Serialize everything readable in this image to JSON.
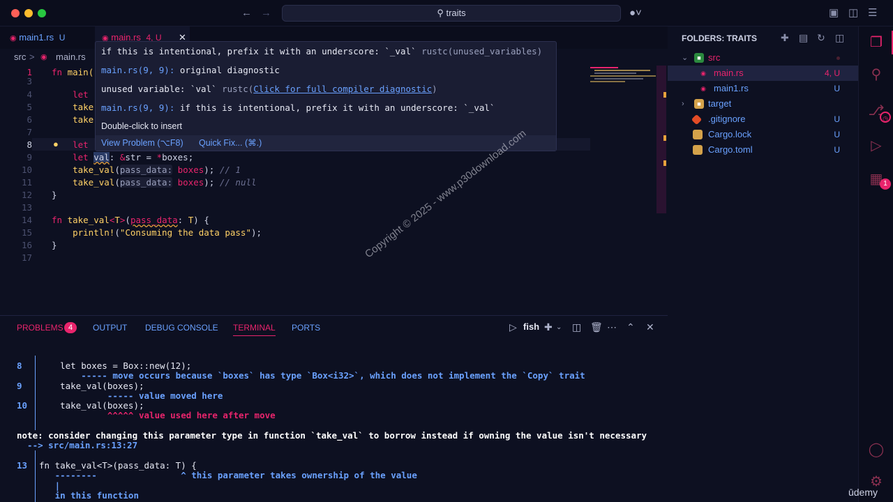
{
  "titlebar": {
    "search_text": "traits"
  },
  "tabs": [
    {
      "label": "main1.rs",
      "status": "U"
    },
    {
      "label": "main.rs",
      "status": "4, U"
    }
  ],
  "breadcrumb": {
    "folder": "src",
    "file": "main.rs",
    "sep": ">"
  },
  "editor": {
    "lines": [
      {
        "n": "1",
        "text": "fn main("
      },
      {
        "n": "3",
        "text": ""
      },
      {
        "n": "4",
        "text": "    let"
      },
      {
        "n": "5",
        "text": "    take"
      },
      {
        "n": "6",
        "text": "    take"
      },
      {
        "n": "7",
        "text": ""
      },
      {
        "n": "8",
        "text": "    let"
      },
      {
        "n": "9",
        "text": "    let val: &str = *boxes;"
      },
      {
        "n": "10",
        "text": "    take_val(pass_data: boxes); // 1"
      },
      {
        "n": "11",
        "text": "    take_val(pass_data: boxes); // null"
      },
      {
        "n": "12",
        "text": "}"
      },
      {
        "n": "13",
        "text": ""
      },
      {
        "n": "14",
        "text": "fn take_val<T>(pass_data: T) {"
      },
      {
        "n": "15",
        "text": "    println!(\"Consuming the data pass\");"
      },
      {
        "n": "16",
        "text": "}"
      },
      {
        "n": "17",
        "text": ""
      }
    ]
  },
  "hover": {
    "line1_a": "if this is intentional, prefix it with an underscore: `_val`",
    "line1_b": "rustc(unused_variables)",
    "line2_link": "main.rs(9, 9):",
    "line2_text": "original diagnostic",
    "line3_a": "unused variable: `val`",
    "line3_b": "rustc(",
    "line3_link": "Click for full compiler diagnostic",
    "line3_c": ")",
    "line4_link": "main.rs(9, 9):",
    "line4_text": "if this is intentional, prefix it with an underscore: `_val`",
    "line5": "Double-click to insert",
    "view_problem": "View Problem (⌥F8)",
    "quick_fix": "Quick Fix... (⌘.)"
  },
  "explorer": {
    "header": "FOLDERS: TRAITS",
    "items": [
      {
        "name": "src",
        "status": ""
      },
      {
        "name": "main.rs",
        "status": "4, U"
      },
      {
        "name": "main1.rs",
        "status": "U"
      },
      {
        "name": "target",
        "status": ""
      },
      {
        "name": ".gitignore",
        "status": "U"
      },
      {
        "name": "Cargo.lock",
        "status": "U"
      },
      {
        "name": "Cargo.toml",
        "status": "U"
      }
    ]
  },
  "activity": {
    "scm_badge": "1"
  },
  "panel": {
    "tabs": {
      "problems": "PROBLEMS",
      "problems_count": "4",
      "output": "OUTPUT",
      "debug": "DEBUG CONSOLE",
      "terminal": "TERMINAL",
      "ports": "PORTS"
    },
    "shell": "fish",
    "terminal_lines": [
      {
        "gutter": "8",
        "text": "    let boxes = Box::new(12);"
      },
      {
        "gutter": "",
        "text": "        ----- move occurs because `boxes` has type `Box<i32>`, which does not implement the `Copy` trait"
      },
      {
        "gutter": "9",
        "text": "    take_val(boxes);"
      },
      {
        "gutter": "",
        "text": "             ----- value moved here"
      },
      {
        "gutter": "10",
        "text": "    take_val(boxes);"
      },
      {
        "gutter": "",
        "text": "             ^^^^^ value used here after move"
      },
      {
        "gutter": "",
        "text": "note: consider changing this parameter type in function `take_val` to borrow instead if owning the value isn't necessary"
      },
      {
        "gutter": "",
        "text": "  --> src/main.rs:13:27"
      },
      {
        "gutter": "13",
        "text": "fn take_val<T>(pass_data: T) {"
      },
      {
        "gutter": "",
        "text": "   --------                ^ this parameter takes ownership of the value"
      },
      {
        "gutter": "",
        "text": "   |"
      },
      {
        "gutter": "",
        "text": "   in this function"
      }
    ]
  },
  "overlay": {
    "watermark": "Copyright © 2025 - www.p30download.com",
    "brand": "ūdemy"
  }
}
